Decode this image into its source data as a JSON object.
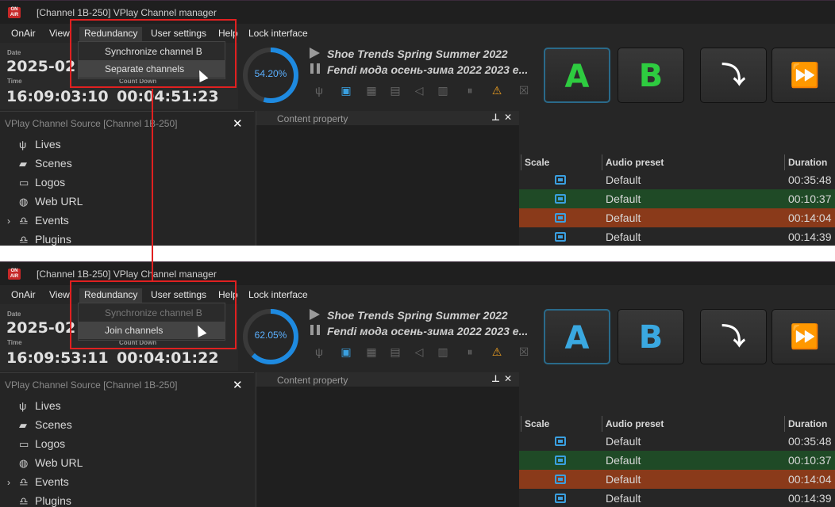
{
  "panels": [
    {
      "title": "[Channel 1B-250] VPlay Channel manager",
      "logo_text": "ON AIR",
      "menu": {
        "onair": "OnAir",
        "view": "View",
        "redundancy": "Redundancy",
        "user_settings": "User settings",
        "help": "Help",
        "lock": "Lock interface"
      },
      "dropdown": {
        "item1": "Synchronize channel B",
        "item1_disabled": false,
        "item2": "Separate channels"
      },
      "date_label": "Date",
      "date_value": "2025-02",
      "time_label": "Time",
      "time_value": "16:09:03:10",
      "countdown_label": "Count Down",
      "countdown_value": "00:04:51:23",
      "progress_text": "54.20%",
      "progress_value": 54.2,
      "clip1": "Shoe Trends Spring Summer 2022",
      "clip2": "Fendi мода осень-зима 2022 2023 e...",
      "btn_a": "A",
      "btn_b": "B",
      "ab_color": "#2ecc40",
      "source_title": "VPlay Channel Source [Channel 1B-250]",
      "content_title": "Content property"
    },
    {
      "title": "[Channel 1B-250] VPlay Channel manager",
      "logo_text": "ON AIR",
      "menu": {
        "onair": "OnAir",
        "view": "View",
        "redundancy": "Redundancy",
        "user_settings": "User settings",
        "help": "Help",
        "lock": "Lock interface"
      },
      "dropdown": {
        "item1": "Synchronize channel B",
        "item1_disabled": true,
        "item2": "Join channels"
      },
      "date_label": "Date",
      "date_value": "2025-02",
      "time_label": "Time",
      "time_value": "16:09:53:11",
      "countdown_label": "Count Down",
      "countdown_value": "00:04:01:22",
      "progress_text": "62.05%",
      "progress_value": 62.05,
      "clip1": "Shoe Trends Spring Summer 2022",
      "clip2": "Fendi мода осень-зима 2022 2023 e...",
      "btn_a": "A",
      "btn_b": "B",
      "ab_color": "#3aa8e0",
      "source_title": "VPlay Channel Source [Channel 1B-250]",
      "content_title": "Content property"
    }
  ],
  "tree": [
    {
      "label": "Lives",
      "icon": "antenna-icon"
    },
    {
      "label": "Scenes",
      "icon": "clapper-icon"
    },
    {
      "label": "Logos",
      "icon": "monitor-icon"
    },
    {
      "label": "Web URL",
      "icon": "globe-icon"
    },
    {
      "label": "Events",
      "icon": "bell-icon",
      "expandable": true
    },
    {
      "label": "Plugins",
      "icon": "bell-icon"
    }
  ],
  "table": {
    "headers": [
      "Scale",
      "Audio preset",
      "Duration"
    ],
    "rows": [
      {
        "preset": "Default",
        "duration": "00:35:48",
        "color": "#262626"
      },
      {
        "preset": "Default",
        "duration": "00:10:37",
        "color": "#1f4a26"
      },
      {
        "preset": "Default",
        "duration": "00:14:04",
        "color": "#8a3a1a"
      },
      {
        "preset": "Default",
        "duration": "00:14:39",
        "color": "#262626"
      }
    ]
  },
  "colors": {
    "accent": "#3aa0e0",
    "highlight": "#e02020"
  }
}
